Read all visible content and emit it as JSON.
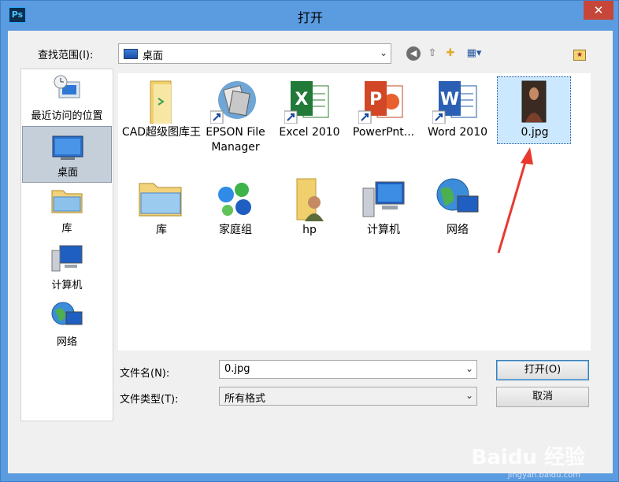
{
  "window": {
    "title": "打开",
    "app_icon": "Ps",
    "close_glyph": "✕"
  },
  "toolbar": {
    "look_in_label": "查找范围(I):",
    "look_in_value": "桌面",
    "icons": [
      "back-icon",
      "up-folder-icon",
      "new-folder-icon",
      "view-menu-icon",
      "favorite-folder-icon"
    ]
  },
  "places": [
    {
      "label": "最近访问的位置",
      "icon": "recent-places-icon"
    },
    {
      "label": "桌面",
      "icon": "desktop-icon",
      "selected": true
    },
    {
      "label": "库",
      "icon": "libraries-icon"
    },
    {
      "label": "计算机",
      "icon": "computer-icon"
    },
    {
      "label": "网络",
      "icon": "network-icon"
    }
  ],
  "files": [
    {
      "label": "CAD超级图库王",
      "icon": "folder-icon"
    },
    {
      "label": "EPSON File Manager",
      "icon": "epson-shortcut-icon"
    },
    {
      "label": "Excel 2010",
      "icon": "excel-icon"
    },
    {
      "label": "PowerPnt...",
      "icon": "powerpoint-icon"
    },
    {
      "label": "Word 2010",
      "icon": "word-icon"
    },
    {
      "label": "0.jpg",
      "icon": "image-thumbnail-icon",
      "selected": true
    },
    {
      "label": "库",
      "icon": "libraries-folder-icon"
    },
    {
      "label": "家庭组",
      "icon": "homegroup-icon"
    },
    {
      "label": "hp",
      "icon": "user-folder-icon"
    },
    {
      "label": "计算机",
      "icon": "computer-icon"
    },
    {
      "label": "网络",
      "icon": "network-icon"
    }
  ],
  "form": {
    "filename_label": "文件名(N):",
    "filename_value": "0.jpg",
    "filetype_label": "文件类型(T):",
    "filetype_value": "所有格式",
    "open_button": "打开(O)",
    "cancel_button": "取消"
  },
  "watermark": {
    "text": "Baidu 经验",
    "url": "jingyan.baidu.com"
  },
  "colors": {
    "title_bar": "#5b9be0",
    "close_button": "#c7463a",
    "selection": "#cce8ff",
    "annotation_arrow": "#e8392f"
  }
}
